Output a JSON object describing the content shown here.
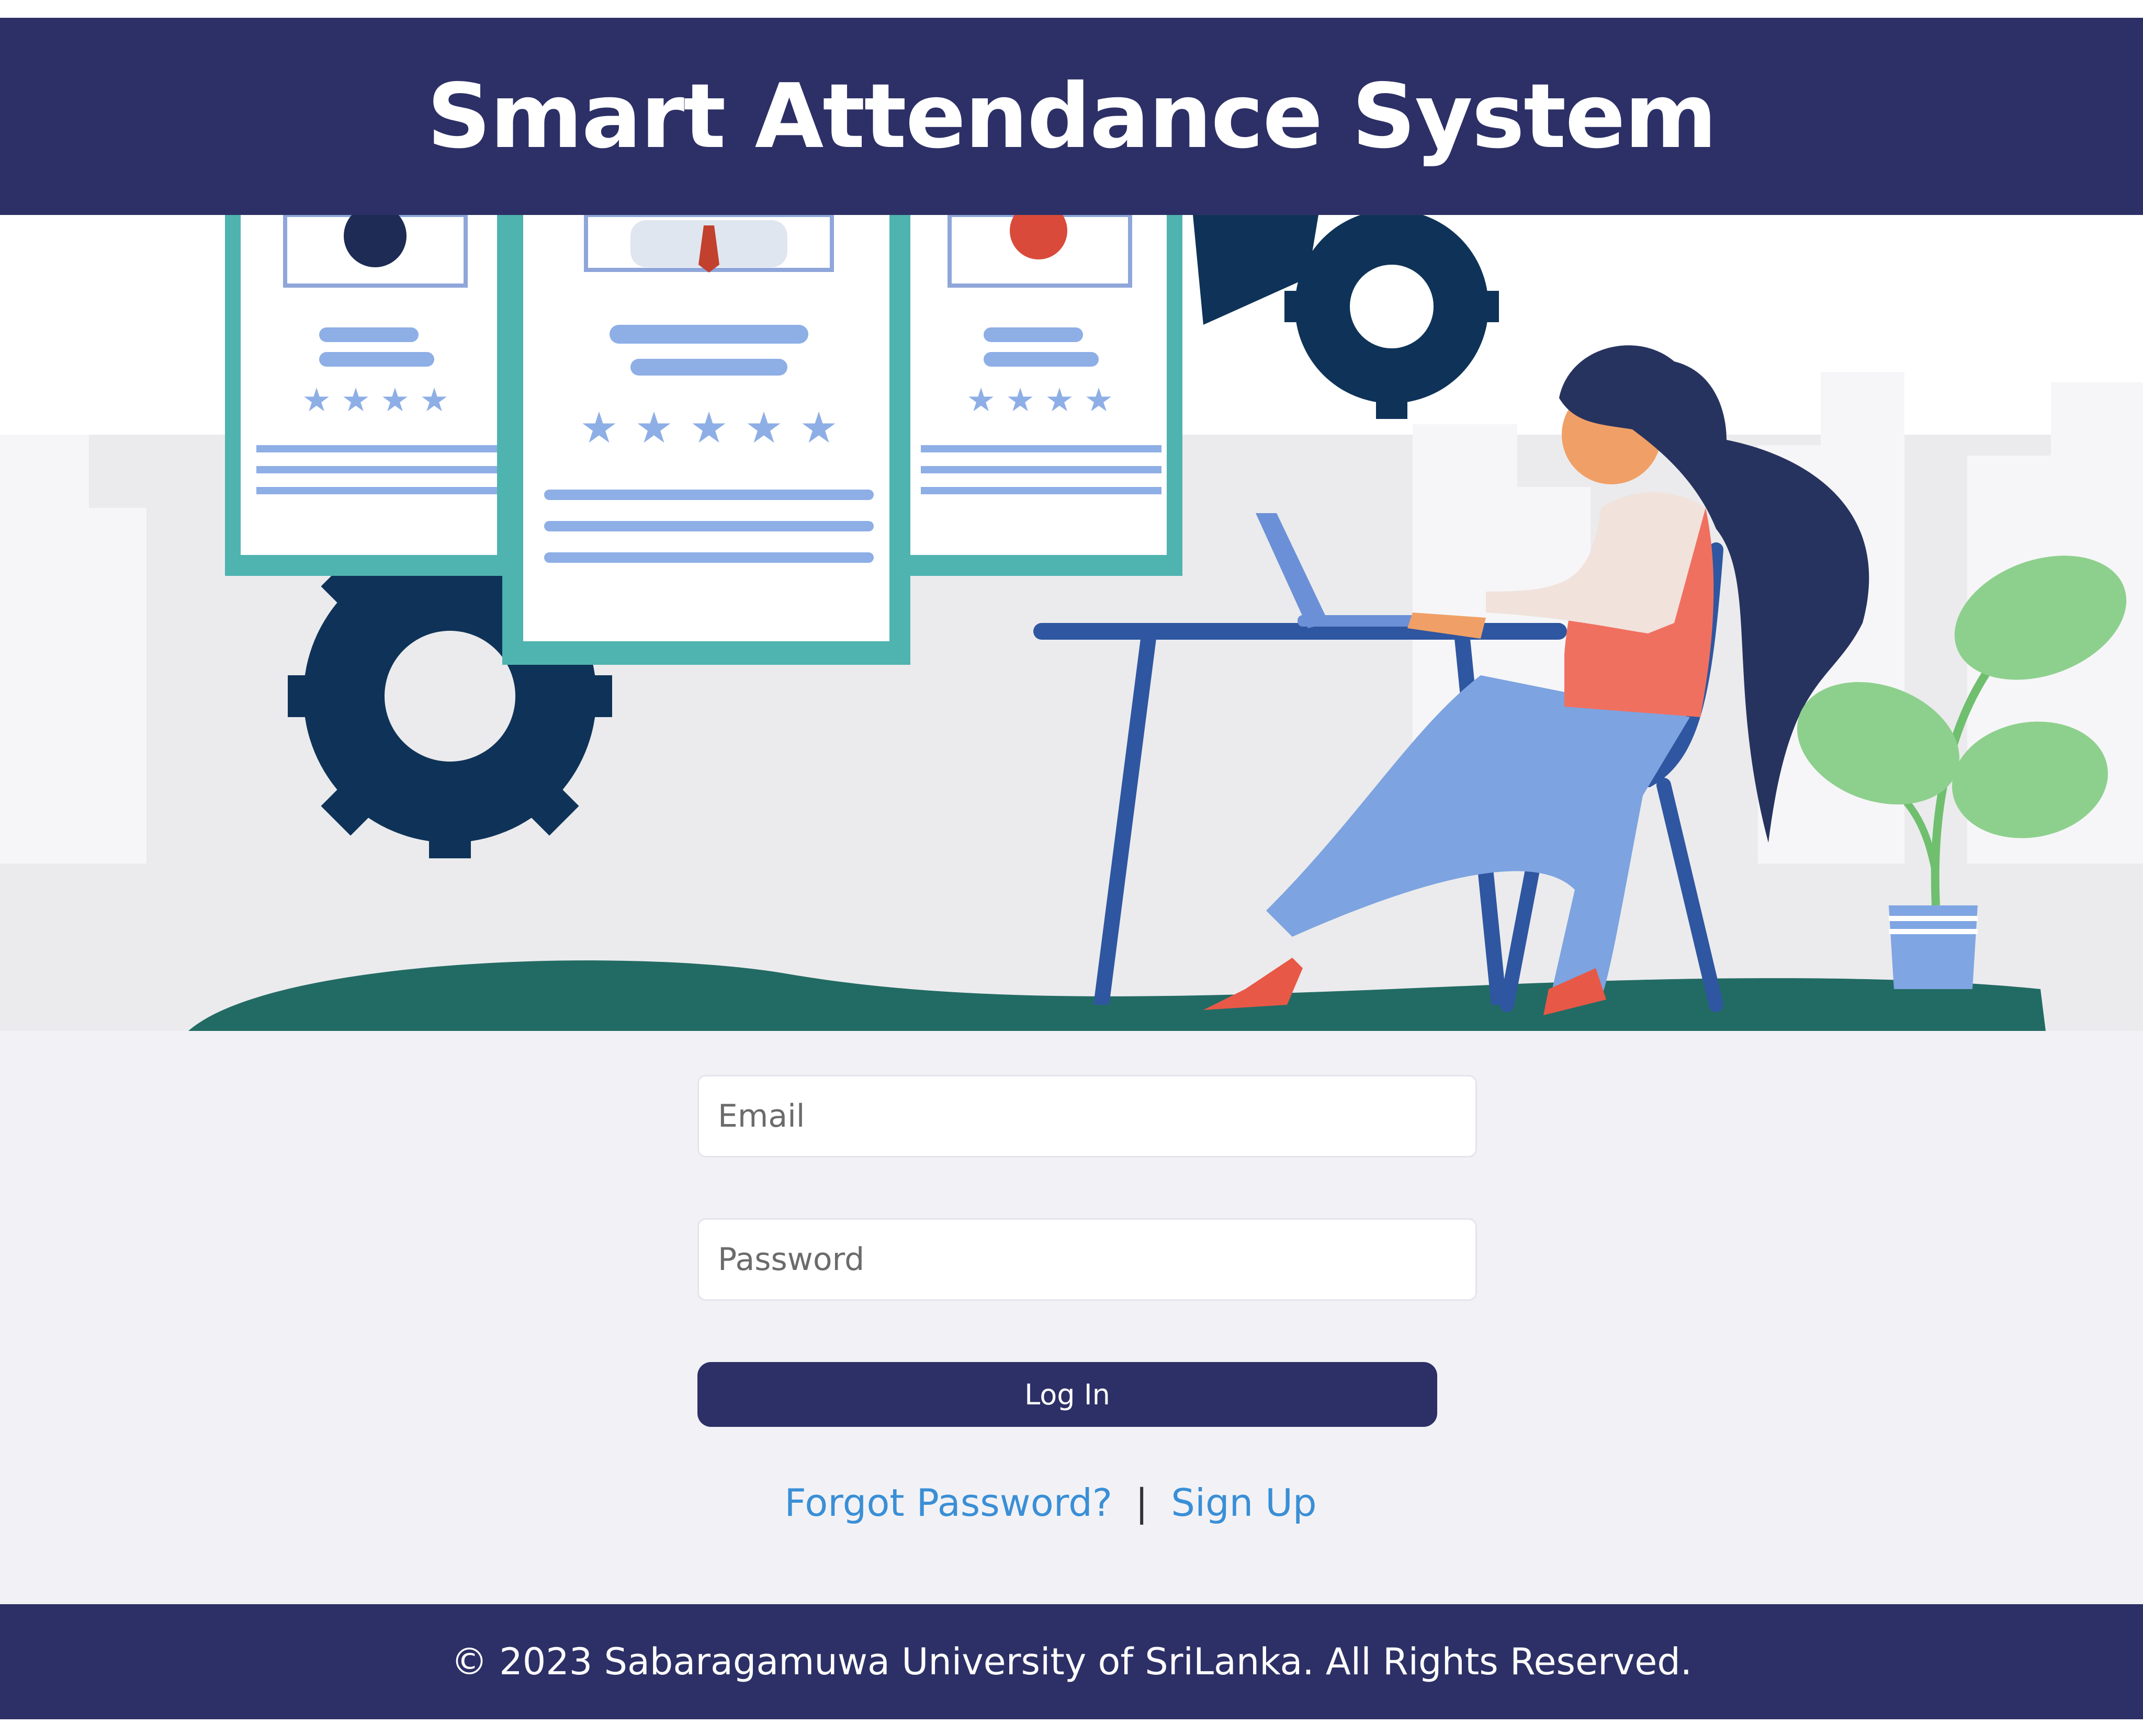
{
  "header": {
    "title": "Smart Attendance System"
  },
  "hero": {
    "illustration": "woman-at-laptop-with-profile-cards-illustration"
  },
  "login_form": {
    "email": {
      "placeholder": "Email",
      "value": ""
    },
    "password": {
      "placeholder": "Password",
      "value": ""
    },
    "login_label": "Log In"
  },
  "links": {
    "forgot_password": "Forgot Password?",
    "separator": "|",
    "sign_up": "Sign Up"
  },
  "footer": {
    "copyright": "© 2023 Sabaragamuwa University of SriLanka. All Rights Reserved."
  },
  "colors": {
    "brand_navy": "#2d3066",
    "link_blue": "#3a8fd6",
    "form_background": "#f2f2f6"
  }
}
